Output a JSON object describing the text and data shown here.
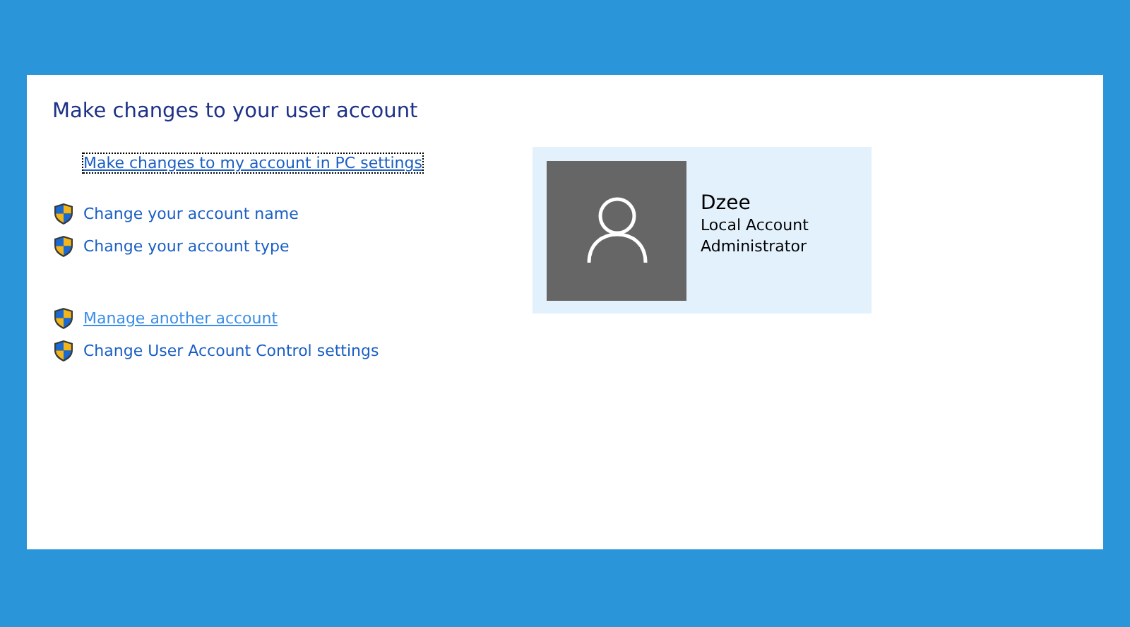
{
  "title": "Make changes to your user account",
  "link_groups": [
    {
      "links": [
        {
          "label": "Make changes to my account in PC settings",
          "kind": "plain",
          "focused": true,
          "hovered": false
        }
      ]
    },
    {
      "links": [
        {
          "label": "Change your account name",
          "kind": "shield",
          "focused": false,
          "hovered": false
        },
        {
          "label": "Change your account type",
          "kind": "shield",
          "focused": false,
          "hovered": false
        }
      ]
    },
    {
      "links": [
        {
          "label": "Manage another account",
          "kind": "shield",
          "focused": false,
          "hovered": true
        },
        {
          "label": "Change User Account Control settings",
          "kind": "shield",
          "focused": false,
          "hovered": false
        }
      ]
    }
  ],
  "account": {
    "name": "Dzee",
    "type": "Local Account",
    "role": "Administrator"
  }
}
